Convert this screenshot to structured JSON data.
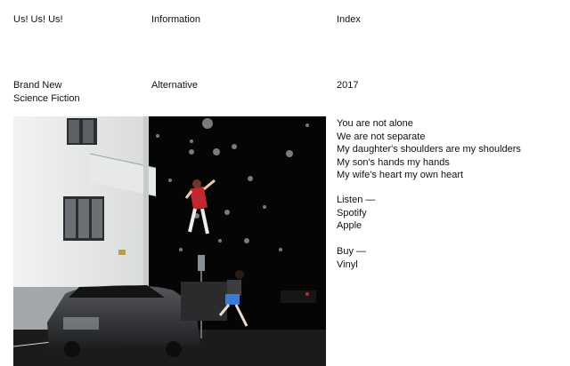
{
  "nav": {
    "home": "Us! Us! Us!",
    "information": "Information",
    "index": "Index"
  },
  "release": {
    "artist_line1": "Brand New",
    "artist_line2": "Science Fiction",
    "genre": "Alternative",
    "year": "2017"
  },
  "lyrics": [
    "You are not alone",
    "We are not separate",
    "My daughter's shoulders are my shoulders",
    "My son's hands my hands",
    "My wife's heart my own heart"
  ],
  "listen": {
    "heading": "Listen —",
    "links": [
      "Spotify",
      "Apple"
    ]
  },
  "buy": {
    "heading": "Buy —",
    "links": [
      "Vinyl"
    ]
  },
  "artwork": {
    "icon": "album-cover-photo",
    "colors": {
      "night": "#050505",
      "wall": "#eceeec",
      "car": "#2f3032",
      "shirt": "#c1272d",
      "skirt": "#3a7bd5"
    }
  }
}
